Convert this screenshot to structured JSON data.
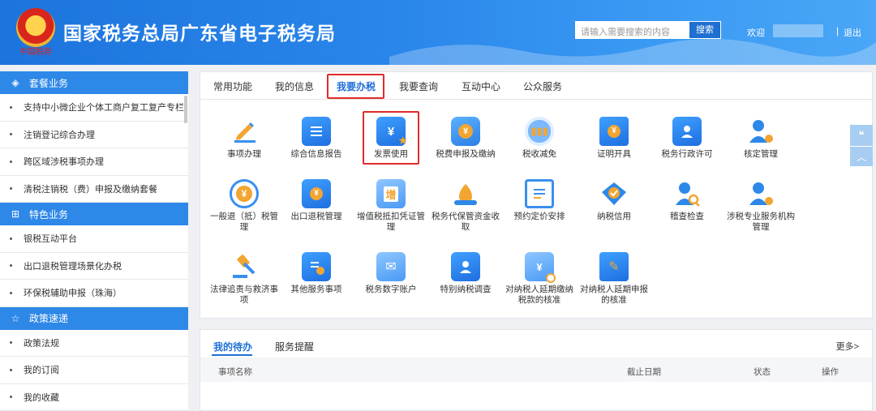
{
  "header": {
    "emblem_sub": "中国税务",
    "title": "国家税务总局广东省电子税务局",
    "search_placeholder": "请输入需要搜索的内容",
    "search_button": "搜索",
    "welcome": "欢迎",
    "separator": "|",
    "logout": "退出"
  },
  "sidebar": {
    "sections": [
      {
        "title": "套餐业务",
        "icon": "cube-icon",
        "items": [
          "支持中小微企业个体工商户复工复产专栏",
          "注销登记综合办理",
          "跨区域涉税事项办理",
          "清税注销税（费）申报及缴纳套餐"
        ]
      },
      {
        "title": "特色业务",
        "icon": "apps-icon",
        "items": [
          "银税互动平台",
          "出口退税管理场景化办税",
          "环保税辅助申报（珠海）"
        ]
      },
      {
        "title": "政策速递",
        "icon": "star-icon",
        "items": [
          "政策法规",
          "我的订阅",
          "我的收藏"
        ]
      }
    ]
  },
  "tabs": [
    "常用功能",
    "我的信息",
    "我要办税",
    "我要查询",
    "互动中心",
    "公众服务"
  ],
  "active_tab": "我要办税",
  "grid": [
    {
      "label": "事项办理",
      "icon": "pen-icon"
    },
    {
      "label": "综合信息报告",
      "icon": "document-list-icon"
    },
    {
      "label": "发票使用",
      "icon": "invoice-star-icon"
    },
    {
      "label": "税费申报及缴纳",
      "icon": "tax-cube-icon"
    },
    {
      "label": "税收减免",
      "icon": "coins-icon"
    },
    {
      "label": "证明开具",
      "icon": "ticket-icon"
    },
    {
      "label": "税务行政许可",
      "icon": "id-card-icon"
    },
    {
      "label": "核定管理",
      "icon": "user-gear-icon"
    },
    {
      "label": "一般退（抵）税管理",
      "icon": "refund-icon"
    },
    {
      "label": "出口退税管理",
      "icon": "export-refund-icon"
    },
    {
      "label": "增值税抵扣凭证管理",
      "icon": "vat-voucher-icon"
    },
    {
      "label": "税务代保管资金收取",
      "icon": "money-bag-icon"
    },
    {
      "label": "预约定价安排",
      "icon": "pricing-doc-icon"
    },
    {
      "label": "纳税信用",
      "icon": "credit-badge-icon"
    },
    {
      "label": "稽查检查",
      "icon": "inspect-user-icon"
    },
    {
      "label": "涉税专业服务机构管理",
      "icon": "agency-gear-icon"
    },
    {
      "label": "法律追责与救济事项",
      "icon": "gavel-icon"
    },
    {
      "label": "其他服务事项",
      "icon": "clipboard-add-icon"
    },
    {
      "label": "税务数字账户",
      "icon": "digital-account-icon"
    },
    {
      "label": "特别纳税调查",
      "icon": "special-survey-icon"
    },
    {
      "label": "对纳税人延期缴纳税款的核准",
      "icon": "deferred-payment-icon"
    },
    {
      "label": "对纳税人延期申报的核准",
      "icon": "deferred-filing-icon"
    }
  ],
  "todo": {
    "tab_active": "我的待办",
    "tab_other": "服务提醒",
    "more": "更多>",
    "columns": [
      "事项名称",
      "截止日期",
      "状态",
      "操作"
    ]
  },
  "colors": {
    "brand_blue": "#2e88e8",
    "highlight_red": "#e02b2b",
    "active_tab": "#1f6fd8"
  }
}
